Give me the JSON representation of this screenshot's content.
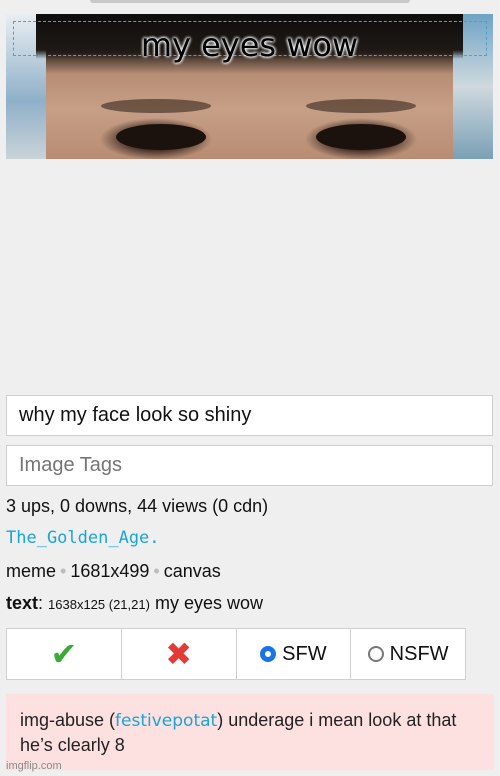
{
  "meme": {
    "caption": "my eyes wow"
  },
  "form": {
    "description_value": "why my face look so shiny",
    "tags_placeholder": "Image Tags"
  },
  "info": {
    "stats": "3 ups, 0 downs, 44 views (0 cdn)",
    "username": "The_Golden_Age.",
    "type": "meme",
    "dimensions": "1681x499",
    "source": "canvas",
    "text_label": "text",
    "text_box": "1638x125 (21,21)",
    "text_value": "my eyes wow"
  },
  "actions": {
    "approve_icon": "check-icon",
    "reject_icon": "cross-icon",
    "sfw_label": "SFW",
    "nsfw_label": "NSFW",
    "selected": "SFW"
  },
  "report": {
    "prefix": "img-abuse (",
    "reporter": "festivepotat",
    "message": ") underage i mean look at that he’s clearly 8"
  },
  "watermark": "imgflip.com",
  "colors": {
    "link": "#1aa5d6",
    "check": "#3aaa35",
    "cross": "#e53935",
    "radio": "#1a73e8",
    "report_bg": "#fde0e0"
  }
}
